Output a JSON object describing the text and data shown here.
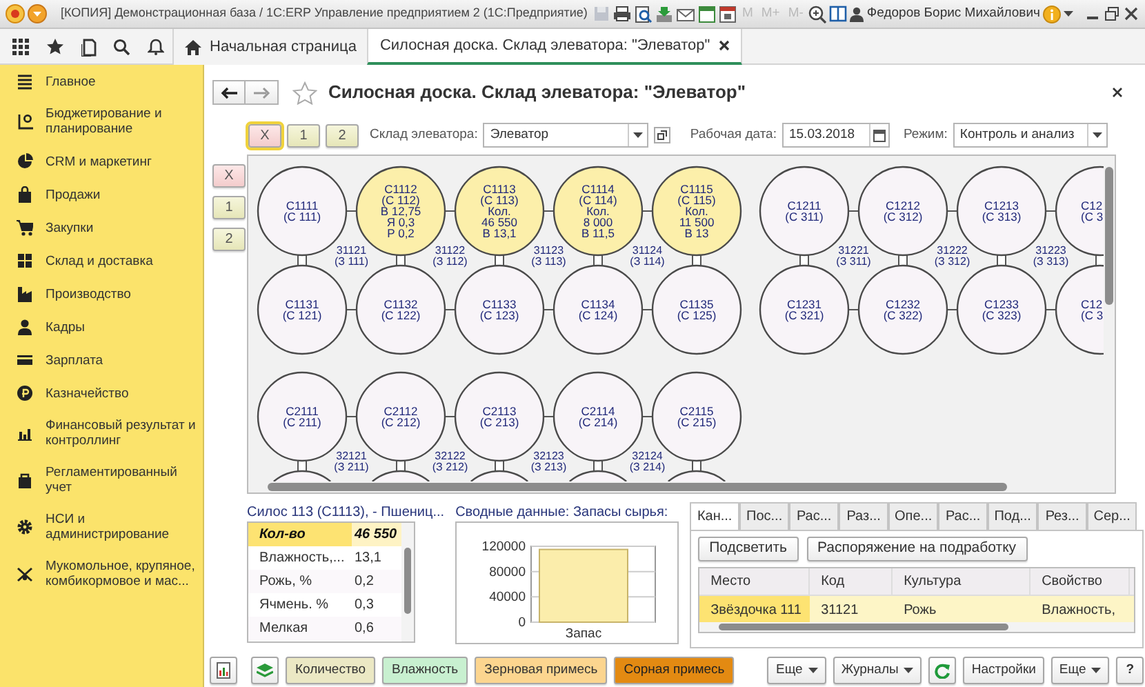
{
  "window": {
    "title": "[КОПИЯ] Демонстрационная база / 1С:ERP Управление предприятием 2  (1С:Предприятие)",
    "memory_buttons": [
      "M",
      "M+",
      "M-"
    ],
    "user": "Федоров Борис Михайлович"
  },
  "tabs": [
    {
      "label": "Начальная страница",
      "selected": false,
      "kind": "home"
    },
    {
      "label": "Силосная доска. Склад элеватора: \"Элеватор\"",
      "selected": true,
      "kind": "document"
    }
  ],
  "sidebar": {
    "items": [
      {
        "label": "Главное"
      },
      {
        "label": "Бюджетирование и планирование"
      },
      {
        "label": "CRM и маркетинг"
      },
      {
        "label": "Продажи"
      },
      {
        "label": "Закупки"
      },
      {
        "label": "Склад и доставка"
      },
      {
        "label": "Производство"
      },
      {
        "label": "Кадры"
      },
      {
        "label": "Зарплата"
      },
      {
        "label": "Казначейство"
      },
      {
        "label": "Финансовый результат и контроллинг"
      },
      {
        "label": "Регламентированный учет"
      },
      {
        "label": "НСИ и администрирование"
      },
      {
        "label": "Мукомольное, крупяное, комбикормовое и мас..."
      }
    ]
  },
  "form": {
    "title": "Силосная доска. Склад элеватора: \"Элеватор\"",
    "filter_buttons": [
      {
        "label": "X",
        "kind": "clear",
        "selected": true
      },
      {
        "label": "1",
        "kind": "level",
        "selected": false
      },
      {
        "label": "2",
        "kind": "level",
        "selected": false
      }
    ],
    "fields": [
      {
        "label": "Склад элеватора:",
        "value": "Элеватор",
        "kind": "select"
      },
      {
        "label": "Рабочая дата:",
        "value": "15.03.2018",
        "kind": "date"
      },
      {
        "label": "Режим:",
        "value": "Контроль и анализ",
        "kind": "select"
      }
    ],
    "side_buttons": [
      {
        "label": "X",
        "kind": "clear"
      },
      {
        "label": "1",
        "kind": "level"
      },
      {
        "label": "2",
        "kind": "level"
      }
    ]
  },
  "silo_board": {
    "groups": [
      {
        "rows": [
          {
            "silos": [
              {
                "lines": [
                  "С1111",
                  "(С 111)"
                ],
                "filled": false
              },
              {
                "lines": [
                  "С1112",
                  "(С 112)",
                  "В 12,75",
                  "Я 0,3",
                  "Р 0,2"
                ],
                "filled": true
              },
              {
                "lines": [
                  "С1113",
                  "(С 113)",
                  "Кол.",
                  "46 550",
                  "В 13,1"
                ],
                "filled": true
              },
              {
                "lines": [
                  "С1114",
                  "(С 114)",
                  "Кол.",
                  "8 000",
                  "В 11,5"
                ],
                "filled": true
              },
              {
                "lines": [
                  "С1115",
                  "(С 115)",
                  "Кол.",
                  "11 500",
                  "В 13"
                ],
                "filled": true
              }
            ],
            "links": [
              {
                "lines": [
                  "31121",
                  "(З 111)"
                ]
              },
              {
                "lines": [
                  "31122",
                  "(З 112)"
                ]
              },
              {
                "lines": [
                  "31123",
                  "(З 113)"
                ]
              },
              {
                "lines": [
                  "31124",
                  "(З 114)"
                ]
              }
            ]
          },
          {
            "silos": [
              {
                "lines": [
                  "С1131",
                  "(С 121)"
                ],
                "filled": false
              },
              {
                "lines": [
                  "С1132",
                  "(С 122)"
                ],
                "filled": false
              },
              {
                "lines": [
                  "С1133",
                  "(С 123)"
                ],
                "filled": false
              },
              {
                "lines": [
                  "С1134",
                  "(С 124)"
                ],
                "filled": false
              },
              {
                "lines": [
                  "С1135",
                  "(С 125)"
                ],
                "filled": false
              }
            ]
          }
        ]
      },
      {
        "rows": [
          {
            "silos": [
              {
                "lines": [
                  "С1211",
                  "(С 311)"
                ],
                "filled": false
              },
              {
                "lines": [
                  "С1212",
                  "(С 312)"
                ],
                "filled": false
              },
              {
                "lines": [
                  "С1213",
                  "(С 313)"
                ],
                "filled": false
              },
              {
                "lines": [
                  "С12",
                  "(С 3"
                ],
                "filled": false,
                "clipped": true
              }
            ],
            "links": [
              {
                "lines": [
                  "31221",
                  "(З 311)"
                ]
              },
              {
                "lines": [
                  "31222",
                  "(З 312)"
                ]
              },
              {
                "lines": [
                  "31223",
                  "(З 313)"
                ]
              }
            ]
          },
          {
            "silos": [
              {
                "lines": [
                  "С1231",
                  "(С 321)"
                ],
                "filled": false
              },
              {
                "lines": [
                  "С1232",
                  "(С 322)"
                ],
                "filled": false
              },
              {
                "lines": [
                  "С1233",
                  "(С 323)"
                ],
                "filled": false
              },
              {
                "lines": [
                  "С12",
                  "(С 3"
                ],
                "filled": false,
                "clipped": true
              }
            ]
          }
        ]
      },
      {
        "rows": [
          {
            "silos": [
              {
                "lines": [
                  "С2111",
                  "(С 211)"
                ],
                "filled": false
              },
              {
                "lines": [
                  "С2112",
                  "(С 212)"
                ],
                "filled": false
              },
              {
                "lines": [
                  "С2113",
                  "(С 213)"
                ],
                "filled": false
              },
              {
                "lines": [
                  "С2114",
                  "(С 214)"
                ],
                "filled": false
              },
              {
                "lines": [
                  "С2115",
                  "(С 215)"
                ],
                "filled": false
              }
            ],
            "links": [
              {
                "lines": [
                  "32121",
                  "(З 211)"
                ]
              },
              {
                "lines": [
                  "32122",
                  "(З 212)"
                ]
              },
              {
                "lines": [
                  "32123",
                  "(З 213)"
                ]
              },
              {
                "lines": [
                  "32124",
                  "(З 214)"
                ]
              }
            ]
          },
          {
            "silos": [
              {
                "filled": false
              },
              {
                "filled": false
              },
              {
                "filled": false
              },
              {
                "filled": false
              },
              {
                "filled": false
              }
            ]
          }
        ]
      }
    ]
  },
  "silo_details": {
    "title": "Силос 113 (С1113), - Пшениц...",
    "rows": [
      {
        "name": "Кол-во",
        "value": "46 550",
        "selected": true
      },
      {
        "name": "Влажность,...",
        "value": "13,1",
        "selected": false
      },
      {
        "name": "Рожь, %",
        "value": "0,2",
        "selected": false
      },
      {
        "name": "Ячмень. %",
        "value": "0,3",
        "selected": false
      },
      {
        "name": "Мелкая",
        "value": "0,6",
        "selected": false
      }
    ]
  },
  "summary": {
    "title": "Сводные данные: Запасы сырья:",
    "chart_data": {
      "type": "bar",
      "categories": [
        "Запас"
      ],
      "values": [
        115000
      ],
      "ylim": [
        0,
        120000
      ],
      "yticks": [
        0,
        40000,
        80000,
        120000
      ]
    }
  },
  "details_tabs": {
    "tabs": [
      {
        "label": "Кан...",
        "selected": true
      },
      {
        "label": "Пос...",
        "selected": false
      },
      {
        "label": "Рас...",
        "selected": false
      },
      {
        "label": "Раз...",
        "selected": false
      },
      {
        "label": "Опе...",
        "selected": false
      },
      {
        "label": "Рас...",
        "selected": false
      },
      {
        "label": "Под...",
        "selected": false
      },
      {
        "label": "Рез...",
        "selected": false
      },
      {
        "label": "Сер...",
        "selected": false
      }
    ],
    "buttons": [
      "Подсветить",
      "Распоряжение на подработку"
    ],
    "table": {
      "columns": [
        "Место",
        "Код",
        "Культура",
        "Свойство"
      ],
      "rows": [
        {
          "cells": [
            "Звёздочка 111",
            "31121",
            "Рожь",
            "Влажность,"
          ],
          "selected": true
        }
      ]
    }
  },
  "footer_buttons": [
    {
      "kind": "icon"
    },
    {
      "kind": "icon"
    },
    {
      "kind": "legend",
      "label": "Количество",
      "color": "#ebe8c4"
    },
    {
      "kind": "legend",
      "label": "Влажность",
      "color": "#c8f0d0"
    },
    {
      "kind": "legend",
      "label": "Зерновая примесь",
      "color": "#fcd58f"
    },
    {
      "kind": "legend",
      "label": "Сорная примесь",
      "color": "#e38a12"
    },
    {
      "kind": "spacer"
    },
    {
      "kind": "menu",
      "label": "Еще"
    },
    {
      "kind": "menu",
      "label": "Журналы"
    },
    {
      "kind": "icon"
    },
    {
      "kind": "plain",
      "label": "Настройки"
    },
    {
      "kind": "menu",
      "label": "Еще"
    },
    {
      "kind": "plain",
      "label": "?"
    }
  ]
}
